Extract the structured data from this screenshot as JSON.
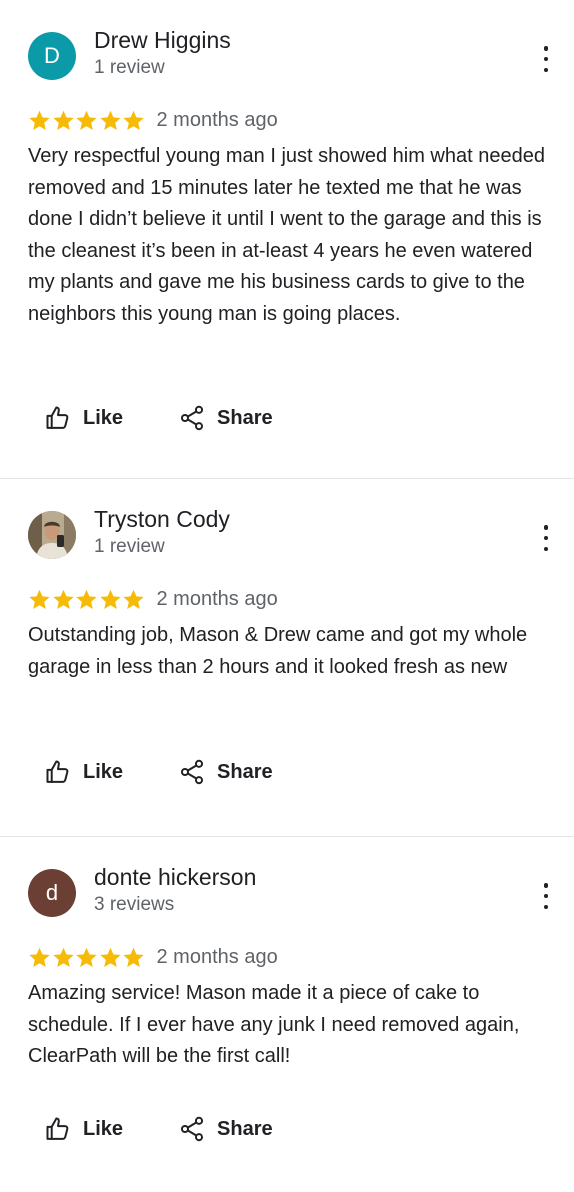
{
  "colors": {
    "star": "#f6bb06",
    "avatar_1": "#0b9ba8",
    "avatar_3": "#6b3f33"
  },
  "reviews": [
    {
      "initial": "D",
      "name": "Drew Higgins",
      "review_count": "1 review",
      "date": "2 months ago",
      "rating": 5,
      "text": "Very respectful young man I just showed him what needed removed and 15 minutes later he texted me that he was done I didn’t believe it until I went to the garage and this is the cleanest it’s been in at-least 4 years he even watered my plants and gave me his business cards to give to the neighbors this young man is going places.",
      "like_label": "Like",
      "share_label": "Share"
    },
    {
      "initial": "",
      "name": "Tryston Cody",
      "review_count": "1 review",
      "date": "2 months ago",
      "rating": 5,
      "text": "Outstanding job, Mason & Drew came and got my whole garage in less than 2 hours and it looked fresh as new",
      "like_label": "Like",
      "share_label": "Share"
    },
    {
      "initial": "d",
      "name": "donte hickerson",
      "review_count": "3 reviews",
      "date": "2 months ago",
      "rating": 5,
      "text": "Amazing service! Mason made it a piece of cake to schedule. If I ever have any junk I need removed again, ClearPath will be the first call!",
      "like_label": "Like",
      "share_label": "Share"
    }
  ]
}
